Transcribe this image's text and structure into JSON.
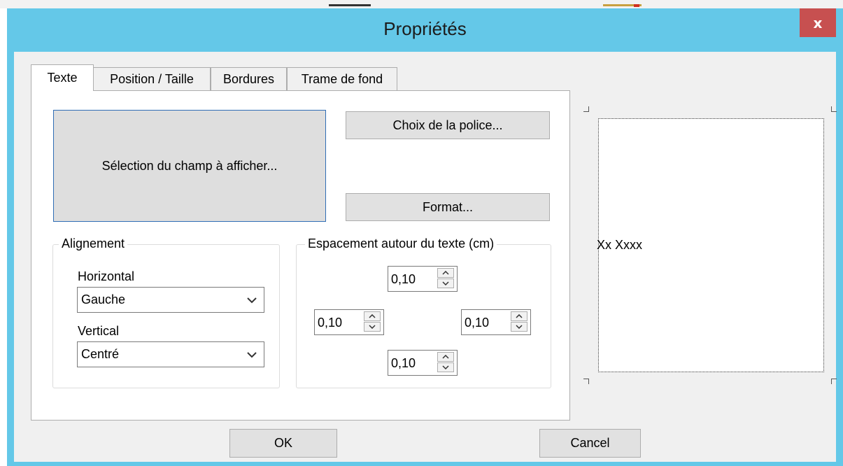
{
  "window": {
    "title": "Propriétés",
    "close_label": "x",
    "title_bar_color": "#64c8e8",
    "close_button_color": "#c75050"
  },
  "tabs": [
    {
      "label": "Texte",
      "active": true
    },
    {
      "label": "Position / Taille",
      "active": false
    },
    {
      "label": "Bordures",
      "active": false
    },
    {
      "label": "Trame de fond",
      "active": false
    }
  ],
  "text_tab": {
    "field_button_label": "Sélection du champ à afficher...",
    "font_button_label": "Choix de la police...",
    "format_button_label": "Format...",
    "alignment": {
      "legend": "Alignement",
      "horizontal_label": "Horizontal",
      "horizontal_value": "Gauche",
      "vertical_label": "Vertical",
      "vertical_value": "Centré"
    },
    "spacing": {
      "legend": "Espacement autour du texte (cm)",
      "top": "0,10",
      "left": "0,10",
      "right": "0,10",
      "bottom": "0,10"
    }
  },
  "preview": {
    "sample_text": "Xx Xxxx"
  },
  "footer": {
    "ok_label": "OK",
    "cancel_label": "Cancel"
  },
  "icons": [
    "close-icon",
    "chevron-down-icon",
    "spin-up-icon",
    "spin-down-icon"
  ]
}
